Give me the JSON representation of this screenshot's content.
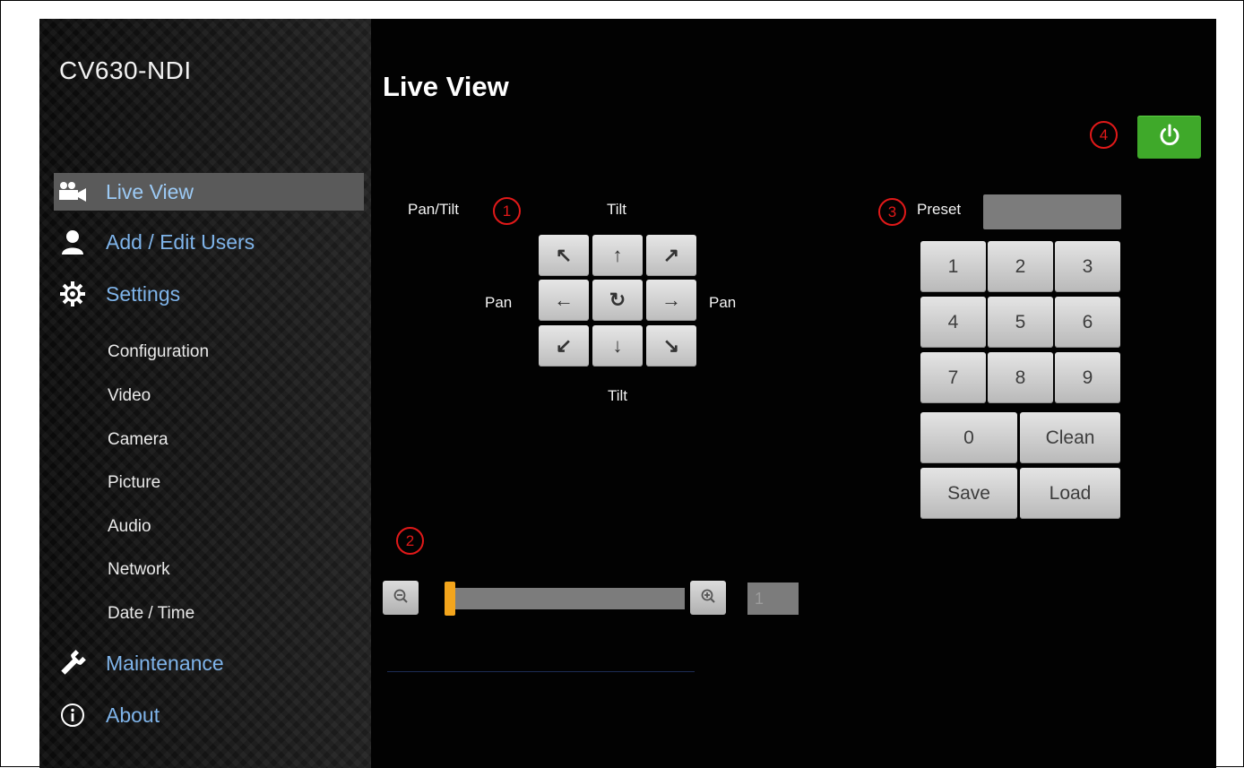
{
  "app": {
    "device_name": "CV630-NDI",
    "page_title": "Live View"
  },
  "sidebar": {
    "items": [
      {
        "label": "Live View",
        "icon": "video-camera-icon",
        "active": true
      },
      {
        "label": "Add / Edit Users",
        "icon": "user-icon"
      },
      {
        "label": "Settings",
        "icon": "gear-icon"
      },
      {
        "label": "Maintenance",
        "icon": "wrench-icon"
      },
      {
        "label": "About",
        "icon": "info-icon"
      }
    ],
    "settings_sub": [
      "Configuration",
      "Video",
      "Camera",
      "Picture",
      "Audio",
      "Network",
      "Date / Time"
    ]
  },
  "ptz": {
    "pan_tilt_label": "Pan/Tilt",
    "tilt_top": "Tilt",
    "tilt_bottom": "Tilt",
    "pan_left": "Pan",
    "pan_right": "Pan",
    "buttons": {
      "up_left": "↖",
      "up": "↑",
      "up_right": "↗",
      "left": "←",
      "home": "↻",
      "right": "→",
      "down_left": "↙",
      "down": "↓",
      "down_right": "↘"
    }
  },
  "preset": {
    "label": "Preset",
    "value": "",
    "keys": [
      "1",
      "2",
      "3",
      "4",
      "5",
      "6",
      "7",
      "8",
      "9",
      "0",
      "Clean",
      "Save",
      "Load"
    ]
  },
  "zoom": {
    "value": "1",
    "level_fraction": 0.0,
    "zoom_out_icon": "zoom-out-icon",
    "zoom_in_icon": "zoom-in-icon"
  },
  "markers": [
    "1",
    "2",
    "3",
    "4"
  ],
  "colors": {
    "background": "#020202",
    "nav_link": "#7fb4ea",
    "active_nav_bg": "#5a5a5a",
    "power_button": "#3fa92a",
    "zoom_thumb": "#f3a51c",
    "marker": "#e11919"
  }
}
